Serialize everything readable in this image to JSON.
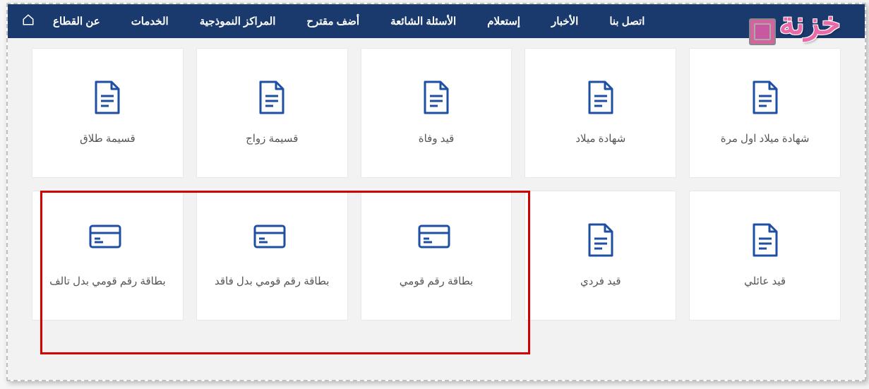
{
  "nav": {
    "items": [
      "عن القطاع",
      "الخدمات",
      "المراكز النموذجية",
      "أضف مقترح",
      "الأسئلة الشائعة",
      "إستعلام",
      "الأخبار",
      "اتصل بنا"
    ]
  },
  "logo": {
    "text": "خزنة"
  },
  "cards": {
    "row1": [
      {
        "label": "شهادة ميلاد اول مرة",
        "icon": "doc"
      },
      {
        "label": "شهادة ميلاد",
        "icon": "doc"
      },
      {
        "label": "قيد وفاة",
        "icon": "doc"
      },
      {
        "label": "قسيمة زواج",
        "icon": "doc"
      },
      {
        "label": "قسيمة طلاق",
        "icon": "doc"
      }
    ],
    "row2": [
      {
        "label": "قيد عائلي",
        "icon": "doc"
      },
      {
        "label": "قيد فردي",
        "icon": "doc"
      },
      {
        "label": "بطاقة رقم قومي",
        "icon": "card"
      },
      {
        "label": "بطاقة رقم قومي بدل فاقد",
        "icon": "card"
      },
      {
        "label": "بطاقة رقم قومي بدل تالف",
        "icon": "card"
      }
    ]
  },
  "colors": {
    "primary": "#1a3a6e",
    "icon": "#1e4fa3"
  }
}
